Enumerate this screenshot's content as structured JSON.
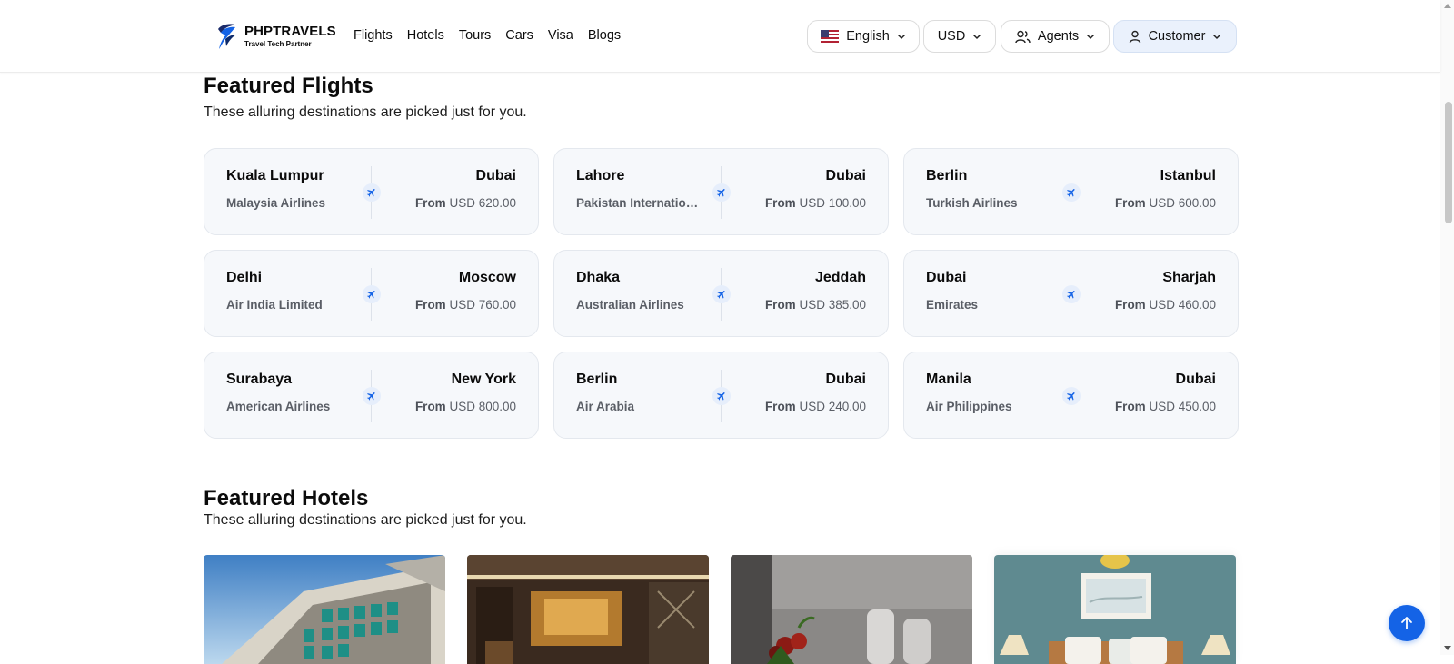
{
  "header": {
    "brand_name": "PHPTRAVELS",
    "brand_tagline": "Travel Tech Partner",
    "nav": [
      "Flights",
      "Hotels",
      "Tours",
      "Cars",
      "Visa",
      "Blogs"
    ],
    "language": "English",
    "currency": "USD",
    "agents": "Agents",
    "customer": "Customer"
  },
  "flights_section": {
    "title": "Featured Flights",
    "subtitle": "These alluring destinations are picked just for you.",
    "from_label": "From",
    "cards": [
      {
        "from": "Kuala Lumpur",
        "to": "Dubai",
        "airline": "Malaysia Airlines",
        "price": "USD 620.00"
      },
      {
        "from": "Lahore",
        "to": "Dubai",
        "airline": "Pakistan International Airlines",
        "price": "USD 100.00"
      },
      {
        "from": "Berlin",
        "to": "Istanbul",
        "airline": "Turkish Airlines",
        "price": "USD 600.00"
      },
      {
        "from": "Delhi",
        "to": "Moscow",
        "airline": "Air India Limited",
        "price": "USD 760.00"
      },
      {
        "from": "Dhaka",
        "to": "Jeddah",
        "airline": "Australian Airlines",
        "price": "USD 385.00"
      },
      {
        "from": "Dubai",
        "to": "Sharjah",
        "airline": "Emirates",
        "price": "USD 460.00"
      },
      {
        "from": "Surabaya",
        "to": "New York",
        "airline": "American Airlines",
        "price": "USD 800.00"
      },
      {
        "from": "Berlin",
        "to": "Dubai",
        "airline": "Air Arabia",
        "price": "USD 240.00"
      },
      {
        "from": "Manila",
        "to": "Dubai",
        "airline": "Air Philippines",
        "price": "USD 450.00"
      }
    ]
  },
  "hotels_section": {
    "title": "Featured Hotels",
    "subtitle": "These alluring destinations are picked just for you."
  },
  "colors": {
    "accent": "#1463e6",
    "card_bg": "#f6f8fb",
    "muted_text": "#5a5e66"
  },
  "icons": {
    "plane": "plane-icon",
    "back_to_top": "arrow-up-icon"
  }
}
